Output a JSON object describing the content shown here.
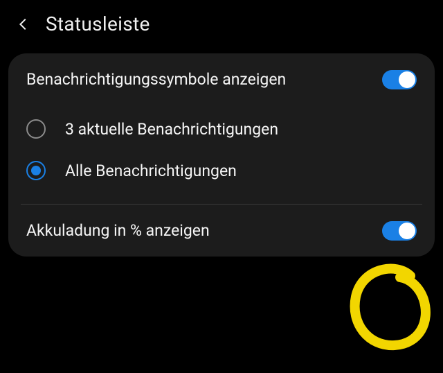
{
  "header": {
    "title": "Statusleiste"
  },
  "settings": {
    "show_icons": {
      "label": "Benachrichtigungssymbole anzeigen",
      "enabled": true,
      "options": [
        {
          "label": "3 aktuelle Benachrichtigungen",
          "selected": false
        },
        {
          "label": "Alle Benachrichtigungen",
          "selected": true
        }
      ]
    },
    "battery_percent": {
      "label": "Akkuladung in % anzeigen",
      "enabled": true
    }
  },
  "colors": {
    "accent": "#1a80e5",
    "annotation": "#f2d600"
  }
}
